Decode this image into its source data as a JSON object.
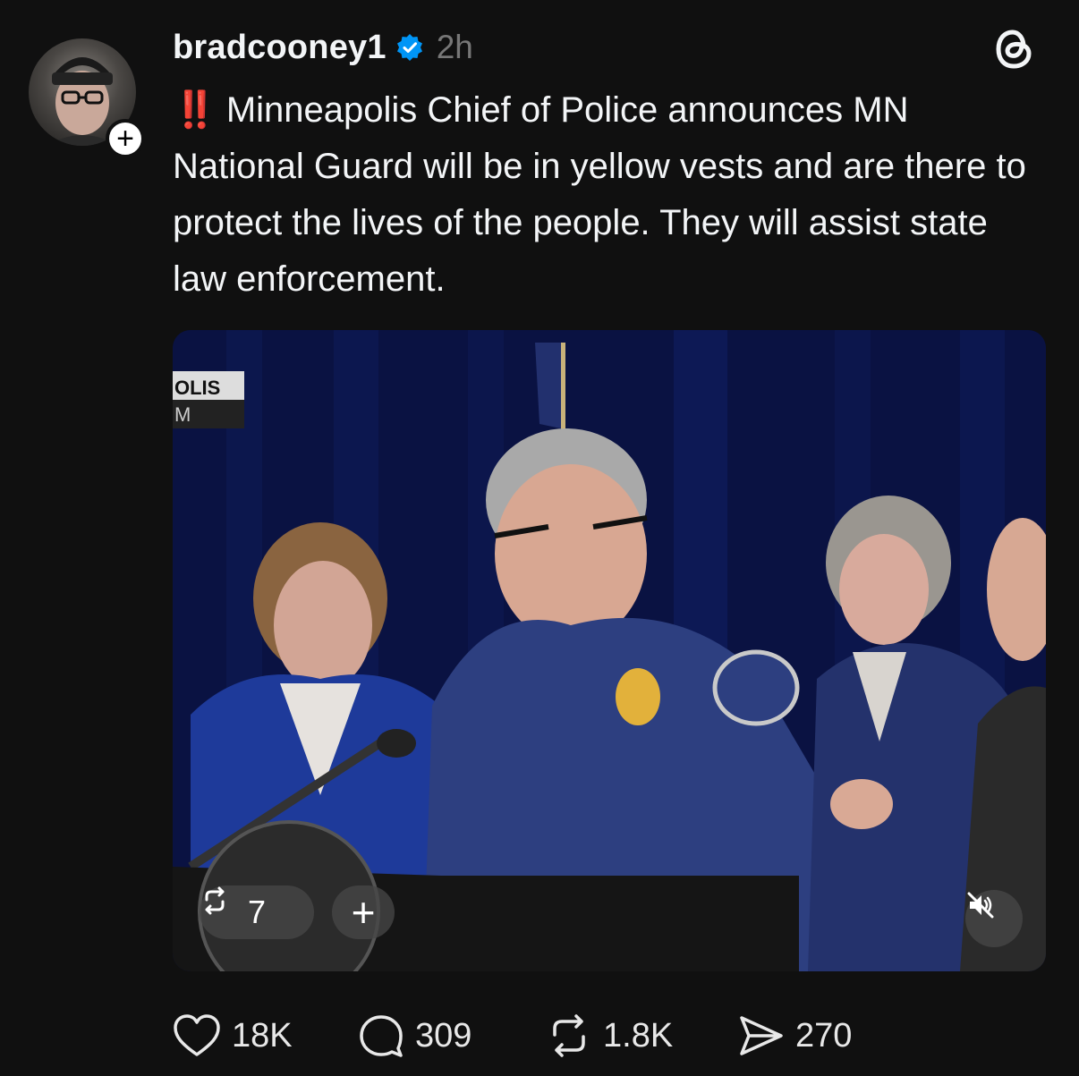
{
  "post": {
    "username": "bradcooney1",
    "time": "2h",
    "emoji": "‼️",
    "text": "Minneapolis Chief of Police announces MN National Guard will be in yellow vests and are there to protect the lives of the people. They will assist state law enforcement.",
    "follow_label": "+",
    "verified": true
  },
  "media": {
    "overlay_sign_text": "OLIS",
    "overlay_sign_sub": "M",
    "repost_count": "7",
    "add_label": "+",
    "muted": true
  },
  "actions": {
    "likes": "18K",
    "replies": "309",
    "reposts": "1.8K",
    "shares": "270"
  },
  "colors": {
    "background": "#101010",
    "text": "#f3f5f7",
    "muted_text": "#777777",
    "verified_blue": "#0095f6",
    "alert_red": "#e0332f"
  },
  "icons": [
    "plus-icon",
    "verified-badge-icon",
    "threads-logo-icon",
    "repost-icon",
    "mute-icon",
    "heart-icon",
    "comment-icon",
    "send-icon"
  ]
}
